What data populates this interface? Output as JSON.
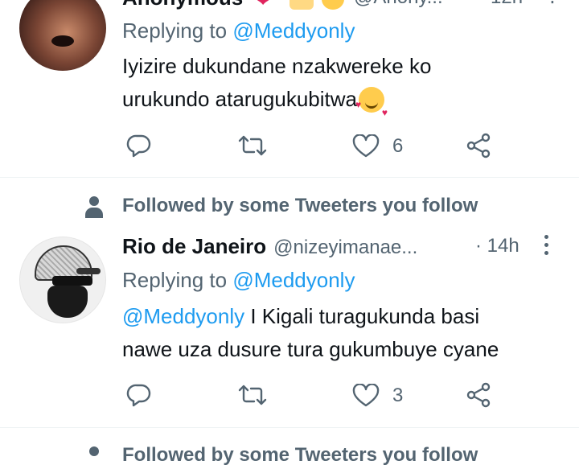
{
  "tweet1": {
    "name_partial": "Anonymous",
    "handle_partial": "@Anony...",
    "time_partial": "12h",
    "replying_prefix": "Replying to",
    "replying_handle": "@Meddyonly",
    "text_line1": "Iyizire dukundane nzakwereke ko",
    "text_line2": "urukundo atarugukubitwa",
    "like_count": "6"
  },
  "tweet2": {
    "social_context": "Followed by some Tweeters you follow",
    "name": "Rio de Janeiro",
    "handle": "@nizeyimanae...",
    "time": "· 14h",
    "replying_prefix": "Replying to",
    "replying_handle": "@Meddyonly",
    "mention": "@Meddyonly",
    "text_line1_rest": " I Kigali turagukunda basi",
    "text_line2": "nawe uza dusure tura gukumbuye cyane",
    "like_count": "3"
  },
  "next": {
    "social_context": "Followed by some Tweeters you follow"
  },
  "colors": {
    "accent": "#1d9bf0",
    "muted": "#536471",
    "divider": "#eff3f4"
  }
}
